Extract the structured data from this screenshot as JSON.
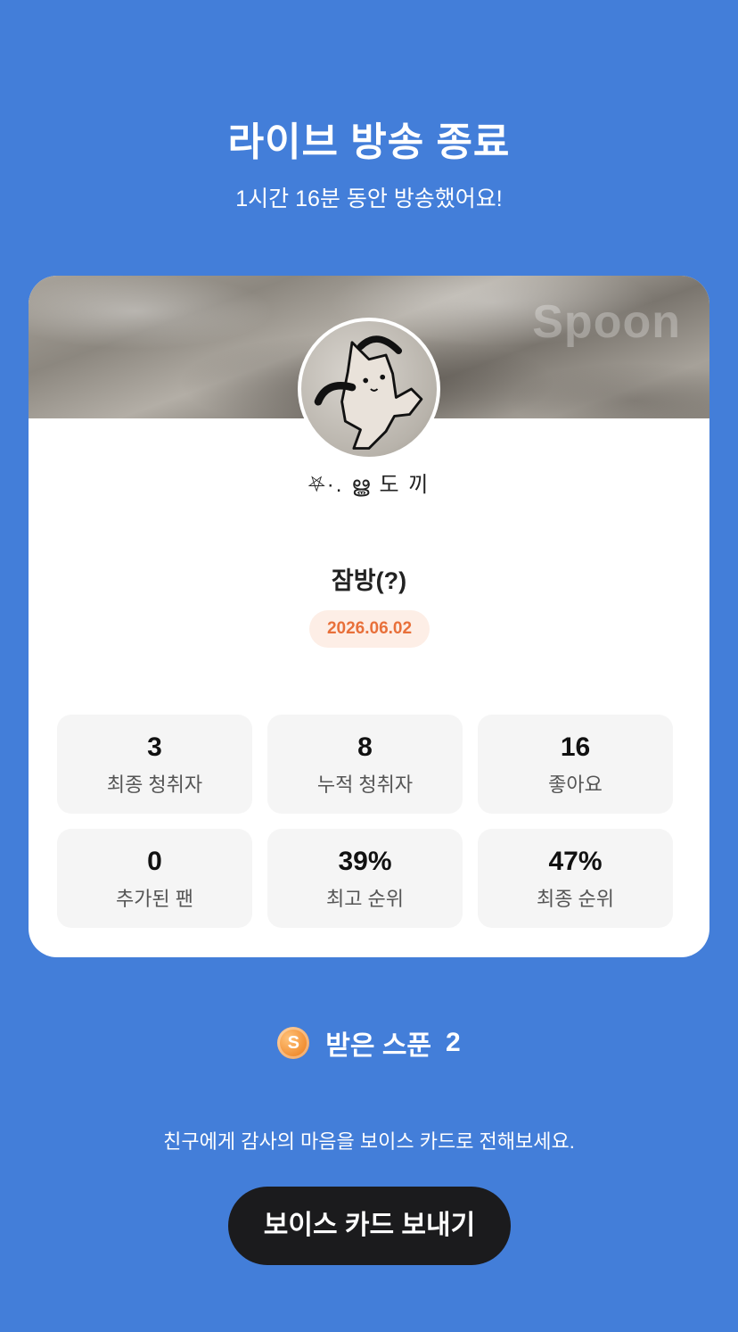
{
  "header": {
    "title": "라이브 방송 종료",
    "subtitle": "1시간 16분 동안 방송했어요!"
  },
  "card": {
    "watermark": "Spoon",
    "nickname": "⛧·. ൠ 도 끼",
    "live_title": "잠방(?)",
    "date": "2026.06.02",
    "stats": [
      {
        "value": "3",
        "label": "최종 청취자"
      },
      {
        "value": "8",
        "label": "누적 청취자"
      },
      {
        "value": "16",
        "label": "좋아요"
      },
      {
        "value": "0",
        "label": "추가된 팬"
      },
      {
        "value": "39%",
        "label": "최고 순위"
      },
      {
        "value": "47%",
        "label": "최종 순위"
      }
    ]
  },
  "spoons": {
    "icon": "spoon-coin-icon",
    "coin_letter": "S",
    "label": "받은 스푼",
    "count": "2"
  },
  "thanks_text": "친구에게 감사의 마음을 보이스 카드로 전해보세요.",
  "voice_card_button": "보이스 카드 보내기",
  "colors": {
    "background": "#437ed9",
    "date_badge_bg": "#fdeee6",
    "date_badge_text": "#e8703a",
    "button_bg": "#1b1b1d"
  }
}
